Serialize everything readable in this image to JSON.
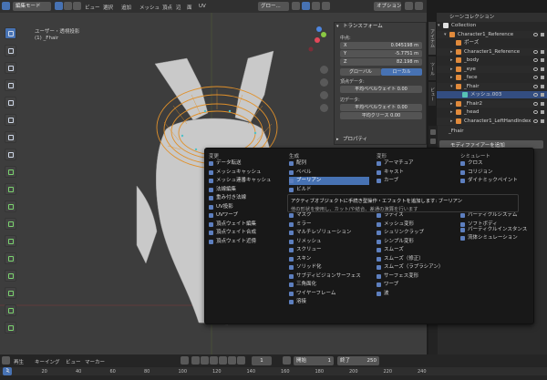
{
  "header": {
    "mode": "編集モード",
    "menus": [
      "ビュー",
      "選択",
      "追加",
      "メッシュ",
      "頂点",
      "辺",
      "面",
      "UV"
    ],
    "transform_orientation": "グロー...",
    "options": "オプション"
  },
  "viewport": {
    "view_name": "ユーザー・透視投影",
    "object_name": "(1) _Fhair"
  },
  "npanel": {
    "section_title": "トランスフォーム",
    "median_label": "中点:",
    "x_label": "X",
    "x_value": "0.045198 m",
    "y_label": "Y",
    "y_value": "-5.7751 m",
    "z_label": "Z",
    "z_value": "82.198 m",
    "global": "グローバル",
    "local": "ローカル",
    "vertex_data": "頂点データ:",
    "mean_bevel_weight": "平均ベベルウェイト",
    "mean_bevel_weight_value": "0.00",
    "edge_data": "辺データ:",
    "mean_bevel_weight2": "平均ベベルウェイト",
    "mean_bevel_weight2_value": "0.00",
    "mean_crease": "平均クリース",
    "mean_crease_value": "0.00",
    "properties": "プロパティ",
    "tabs": [
      "アイテム",
      "ツール",
      "ビュー"
    ]
  },
  "outliner": {
    "title": "シーンコレクション",
    "rows": [
      {
        "label": "Collection",
        "indent": 1,
        "arrow": "▾",
        "color": "#e0e0e0"
      },
      {
        "label": "Character1_Reference",
        "indent": 2,
        "arrow": "▾",
        "color": "#e08a3c"
      },
      {
        "label": "ポーズ",
        "indent": 3,
        "arrow": "",
        "color": "#e08a3c"
      },
      {
        "label": "Character1_Reference",
        "indent": 3,
        "arrow": "▸",
        "color": "#e08a3c"
      },
      {
        "label": "_body",
        "indent": 3,
        "arrow": "▸",
        "color": "#e08a3c"
      },
      {
        "label": "_eye",
        "indent": 3,
        "arrow": "▸",
        "color": "#e08a3c"
      },
      {
        "label": "_face",
        "indent": 3,
        "arrow": "▸",
        "color": "#e08a3c"
      },
      {
        "label": "_Fhair",
        "indent": 3,
        "arrow": "▾",
        "color": "#e08a3c"
      },
      {
        "label": "メッシュ.003",
        "indent": 4,
        "arrow": "",
        "color": "#57c2b4"
      },
      {
        "label": "_Fhair2",
        "indent": 3,
        "arrow": "▸",
        "color": "#e08a3c"
      },
      {
        "label": "_head",
        "indent": 3,
        "arrow": "▸",
        "color": "#e08a3c"
      },
      {
        "label": "Character1_LeftHandIndex",
        "indent": 3,
        "arrow": "▸",
        "color": "#e08a3c"
      }
    ]
  },
  "properties": {
    "object_name": "_Fhair",
    "add_modifier": "モディファイアーを追加"
  },
  "menu": {
    "columns": [
      {
        "header": "変更",
        "items": [
          "データ転送",
          "メッシュキャッシュ",
          "メッシュ連番キャッシュ",
          "法線編集",
          "重み付き法線",
          "UV投影",
          "UVワープ",
          "頂点ウェイト編集",
          "頂点ウェイト合成",
          "頂点ウェイト近傍"
        ]
      },
      {
        "header": "生成",
        "items": [
          "配列",
          "ベベル",
          "ブーリアン",
          "ビルド",
          "デシメート",
          "辺分離",
          "マスク",
          "ミラー",
          "マルチレゾリューション",
          "リメッシュ",
          "スクリュー",
          "スキン",
          "ソリッド化",
          "サブディビジョンサーフェス",
          "三角面化",
          "ワイヤーフレーム",
          "溶接"
        ]
      },
      {
        "header": "変形",
        "items": [
          "アーマチュア",
          "キャスト",
          "カーブ",
          "",
          "",
          "",
          "ラティス",
          "メッシュ変形",
          "シュリンクラップ",
          "シンプル変形",
          "スムーズ",
          "スムーズ（修正）",
          "スムーズ（ラプラシアン）",
          "サーフェス変形",
          "ワープ",
          "波"
        ]
      },
      {
        "header": "シミュレート",
        "items": [
          "クロス",
          "コリジョン",
          "ダイナミックペイント",
          "",
          "",
          "",
          "パーティクルシステム",
          "ソフトボディ"
        ]
      }
    ],
    "highlighted": "ブーリアン",
    "simulate_extra1": "パーティクルインスタンス",
    "simulate_extra2": "流体シミュレーション"
  },
  "tooltip": {
    "line1": "アクティブオブジェクトに手続き型操作・エフェクトを追加します: ブーリアン",
    "line2": "他の形状を使用し、カット/や結合、差通の演算を行います"
  },
  "timeline": {
    "playback": "再生",
    "keying": "キーイング",
    "view": "ビュー",
    "marker": "マーカー",
    "current_frame": "1",
    "start_label": "開始",
    "start": "1",
    "end_label": "終了",
    "end": "250",
    "ticks": [
      "1",
      "20",
      "40",
      "60",
      "80",
      "100",
      "120",
      "140",
      "160",
      "180",
      "200",
      "220",
      "240"
    ]
  },
  "colors": {
    "accent": "#4772b3",
    "background": "#3d3d3d",
    "mesh": "#e0902a",
    "model": "#c9c9c9"
  }
}
